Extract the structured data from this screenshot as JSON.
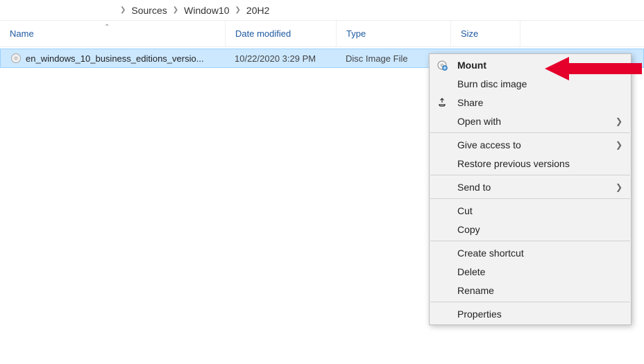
{
  "breadcrumb": {
    "items": [
      "Sources",
      "Window10",
      "20H2"
    ]
  },
  "columns": {
    "name": "Name",
    "date": "Date modified",
    "type": "Type",
    "size": "Size"
  },
  "file": {
    "name": "en_windows_10_business_editions_versio...",
    "date": "10/22/2020 3:29 PM",
    "type": "Disc Image File"
  },
  "menu": {
    "mount": "Mount",
    "burn": "Burn disc image",
    "share": "Share",
    "openwith": "Open with",
    "giveaccess": "Give access to",
    "restore": "Restore previous versions",
    "sendto": "Send to",
    "cut": "Cut",
    "copy": "Copy",
    "shortcut": "Create shortcut",
    "delete": "Delete",
    "rename": "Rename",
    "properties": "Properties"
  }
}
